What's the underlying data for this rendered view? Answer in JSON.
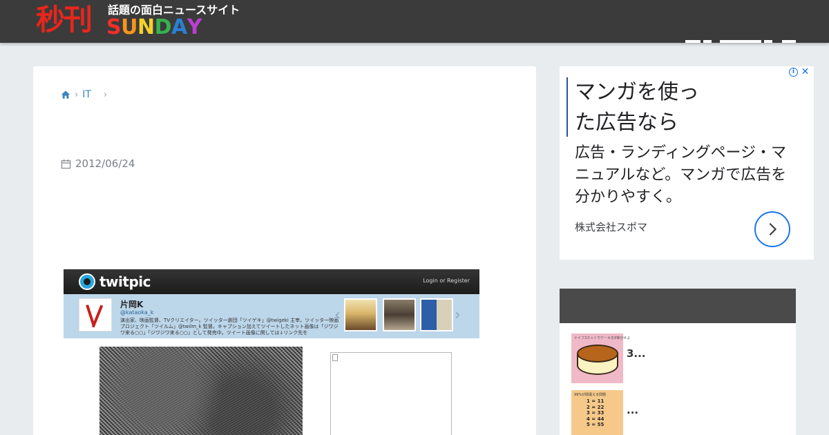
{
  "header": {
    "logo_kanji": "秒刊",
    "logo_tagline": "話題の面白ニュースサイト",
    "logo_sunday_letters": [
      {
        "ch": "S",
        "color": "#f0302a"
      },
      {
        "ch": "U",
        "color": "#f7941d"
      },
      {
        "ch": "N",
        "color": "#f3d12a"
      },
      {
        "ch": "D",
        "color": "#37b24d"
      },
      {
        "ch": "A",
        "color": "#2b7fd4"
      },
      {
        "ch": "Y",
        "color": "#b83fd0"
      }
    ]
  },
  "breadcrumb": {
    "home_icon": "home-icon",
    "category": "IT"
  },
  "article": {
    "date": "2012/06/24"
  },
  "twitpic": {
    "logo": "twitpic",
    "login_text": "Login or Register",
    "profile_name": "片岡K",
    "profile_handle": "@kataoka_k",
    "profile_desc": "演出家、映画監督、TVクリエイター。ツイッター劇団「ツイゲキ」@twigeki 主宰。ツイッター映画プロジェクト「ツイルム」@twilm_k 監督。キャプション加えてツイートしたネット画像は「ジワジワ来る○○」「ジワジワ来る○○」として発売中。ツイート画像に関しては↓リンク先を"
  },
  "ad": {
    "headline": "マンガを使った広告なら",
    "body": "広告・ランディングページ・マニュアルなど。マンガで広告を分かりやすく。",
    "company": "株式会社スポマ"
  },
  "sidebar": {
    "items": [
      {
        "title": "3...",
        "thumb_caption": "ナイフ3カットでケーキを8等分せよ"
      },
      {
        "title": "...",
        "thumb_caption": "99%が間違える問題",
        "thumb_lines": [
          "1 = 11",
          "2 = 22",
          "3 = 33",
          "4 = 44",
          "5 = 55"
        ]
      }
    ]
  },
  "colors": {
    "header_bg": "#3b3b3b",
    "link": "#3b84c4",
    "ad_accent": "#1a73e8"
  }
}
